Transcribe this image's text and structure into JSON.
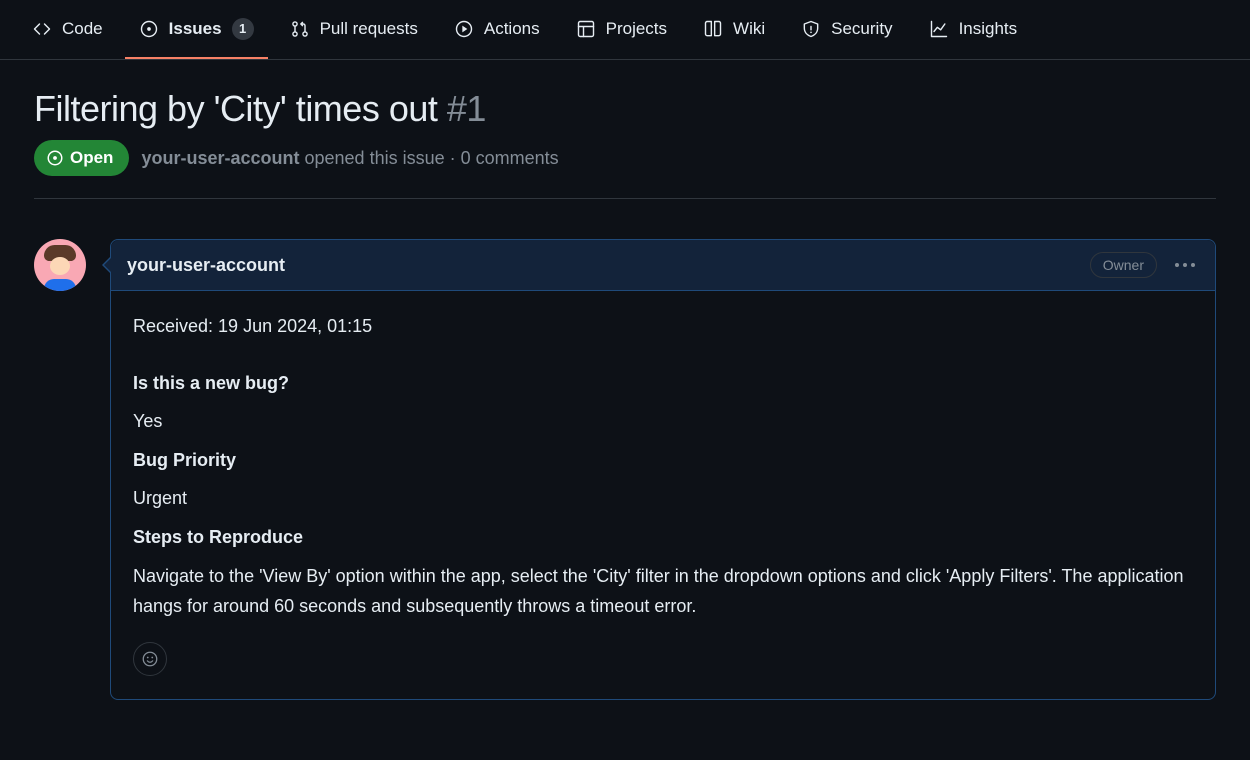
{
  "nav": {
    "items": [
      {
        "label": "Code"
      },
      {
        "label": "Issues",
        "count": "1"
      },
      {
        "label": "Pull requests"
      },
      {
        "label": "Actions"
      },
      {
        "label": "Projects"
      },
      {
        "label": "Wiki"
      },
      {
        "label": "Security"
      },
      {
        "label": "Insights"
      }
    ]
  },
  "issue": {
    "title": "Filtering by 'City' times out",
    "number": "#1",
    "state": "Open",
    "author": "your-user-account",
    "opened_text": "opened this issue · 0 comments"
  },
  "comment": {
    "author": "your-user-account",
    "role": "Owner",
    "received_line": "Received: 19 Jun 2024, 01:15",
    "q1_label": "Is this a new bug?",
    "q1_answer": "Yes",
    "q2_label": "Bug Priority",
    "q2_answer": "Urgent",
    "q3_label": "Steps to Reproduce",
    "q3_answer": "Navigate to the 'View By' option within the app, select the 'City' filter in the dropdown options and click 'Apply Filters'. The application hangs for around 60 seconds and subsequently throws a timeout error."
  }
}
